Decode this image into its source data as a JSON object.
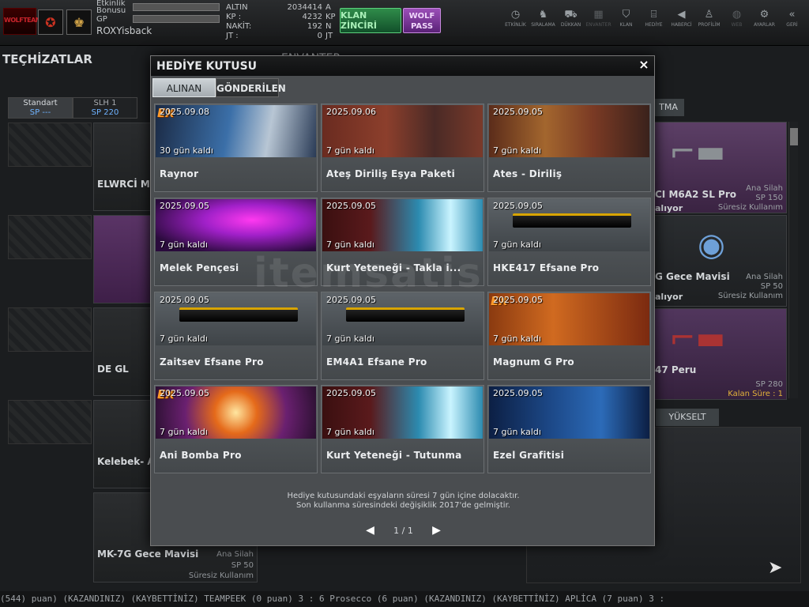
{
  "topbar": {
    "logo_text": "WOLFTEAM",
    "bonus_label": "Etkinlik Bonusu",
    "gp_label": "GP",
    "username": "ROXYisback",
    "currency": [
      {
        "label": "ALTIN",
        "value": "2034414",
        "unit": "A"
      },
      {
        "label": "KP :",
        "value": "4232",
        "unit": "KP"
      },
      {
        "label": "NAKİT:",
        "value": "192",
        "unit": "N"
      },
      {
        "label": "JT :",
        "value": "0",
        "unit": "JT"
      }
    ],
    "clan_button": "KLAN ZİNCİRİ",
    "wolf_pass": "WOLF PASS",
    "nav": [
      {
        "label": "ETKİNLİK",
        "icon": "clock-icon"
      },
      {
        "label": "SIRALAMA",
        "icon": "wolf-icon"
      },
      {
        "label": "DÜKKAN",
        "icon": "cart-icon"
      },
      {
        "label": "ENVANTER",
        "icon": "inventory-icon"
      },
      {
        "label": "KLAN",
        "icon": "shield-icon"
      },
      {
        "label": "HEDİYE",
        "icon": "gift-icon"
      },
      {
        "label": "HABERCİ",
        "icon": "megaphone-icon"
      },
      {
        "label": "PROFİLİM",
        "icon": "profile-icon"
      },
      {
        "label": "WEB",
        "icon": "globe-icon"
      },
      {
        "label": "AYARLAR",
        "icon": "gear-icon"
      },
      {
        "label": "GERİ",
        "icon": "back-icon"
      }
    ]
  },
  "background": {
    "techizat_title": "TEÇHİZATLAR",
    "envanter_title": "ENVANTER",
    "slot_tabs": [
      {
        "name": "Standart",
        "sp": "SP ---"
      },
      {
        "name": "SLH 1",
        "sp": "SP 220"
      }
    ],
    "left_items": [
      "ELWRCİ M",
      "DE GL",
      "Kelebek- A"
    ],
    "bottom_item": {
      "name": "MK-7G Gece Mavisi",
      "category": "Ana Silah",
      "sp": "SP 50",
      "duration": "Süresiz Kullanım"
    },
    "right_header": "TMA",
    "right_items": [
      {
        "name": "CI M6A2 SL Pro",
        "category": "Ana Silah",
        "sp": "SP 150",
        "status": "alıyor",
        "duration": "Süresiz Kullanım"
      },
      {
        "name": "G Gece Mavisi",
        "category": "Ana Silah",
        "sp": "SP 50",
        "status": "alıyor",
        "duration": "Süresiz Kullanım"
      },
      {
        "name": "47 Peru",
        "category": "",
        "sp": "SP 280",
        "status": "",
        "duration": "Kalan Süre : 1"
      }
    ],
    "yukselt": "YÜKSELT",
    "ticker": "(544) puan) (KAZANDINIZ)     (KAYBETTİNİZ) TEAMPEEK (0 puan) 3 : 6 Prosecco (6 puan) (KAZANDINIZ)     (KAYBETTİNİZ) APLİCA (7 puan) 3 :"
  },
  "modal": {
    "title": "HEDİYE KUTUSU",
    "close": "×",
    "tabs": [
      {
        "label": "ALINAN",
        "active": true
      },
      {
        "label": "GÖNDERİLEN",
        "active": false
      }
    ],
    "items": [
      {
        "date": "2025.09.08",
        "days": "30 gün kaldı",
        "title": "Raynor",
        "ex": true,
        "theme": "raynor"
      },
      {
        "date": "2025.09.06",
        "days": "7 gün kaldı",
        "title": "Ateş Diriliş Eşya Paketi",
        "ex": false,
        "theme": "ates"
      },
      {
        "date": "2025.09.05",
        "days": "7 gün kaldı",
        "title": "Ates - Diriliş",
        "ex": false,
        "theme": "ates2"
      },
      {
        "date": "2025.09.05",
        "days": "7 gün kaldı",
        "title": "Melek Pençesi",
        "ex": false,
        "theme": "melek"
      },
      {
        "date": "2025.09.05",
        "days": "7 gün kaldı",
        "title": "Kurt Yeteneği - Takla i...",
        "ex": false,
        "theme": "kurt"
      },
      {
        "date": "2025.09.05",
        "days": "7 gün kaldı",
        "title": "HKE417 Efsane Pro",
        "ex": false,
        "theme": "gun"
      },
      {
        "date": "2025.09.05",
        "days": "7 gün kaldı",
        "title": "Zaitsev Efsane Pro",
        "ex": false,
        "theme": "gun"
      },
      {
        "date": "2025.09.05",
        "days": "7 gün kaldı",
        "title": "EM4A1 Efsane Pro",
        "ex": false,
        "theme": "gun"
      },
      {
        "date": "2025.09.05",
        "days": "7 gün kaldı",
        "title": "Magnum G Pro",
        "ex": true,
        "theme": "magnum"
      },
      {
        "date": "2025.09.05",
        "days": "7 gün kaldı",
        "title": "Ani Bomba Pro",
        "ex": true,
        "theme": "bomba"
      },
      {
        "date": "2025.09.05",
        "days": "7 gün kaldı",
        "title": "Kurt Yeteneği - Tutunma",
        "ex": false,
        "theme": "kurt"
      },
      {
        "date": "2025.09.05",
        "days": "7 gün kaldı",
        "title": "Ezel Grafitisi",
        "ex": false,
        "theme": "ezel"
      }
    ],
    "note_line1": "Hediye kutusundaki eşyaların süresi 7 gün içine dolacaktır.",
    "note_line2": "Son kullanma süresindeki değişiklik 2017'de gelmiştir.",
    "page": "1 / 1",
    "prev": "◀",
    "next": "▶",
    "watermark": "itemsatis"
  }
}
